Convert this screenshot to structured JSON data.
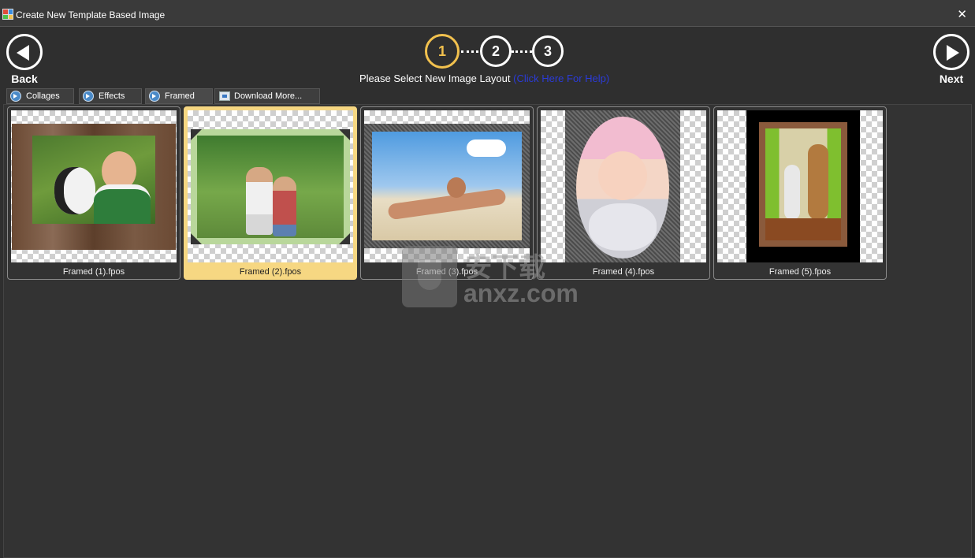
{
  "window": {
    "title": "Create New Template Based Image",
    "close_glyph": "✕"
  },
  "nav": {
    "back_label": "Back",
    "next_label": "Next"
  },
  "steps": {
    "items": [
      "1",
      "2",
      "3"
    ],
    "active": 1
  },
  "subtitle": {
    "text": "Please Select New Image Layout",
    "help_link": "(Click Here For Help)"
  },
  "tabs": [
    {
      "label": "Collages",
      "icon": "arrow-circle-icon"
    },
    {
      "label": "Effects",
      "icon": "arrow-circle-icon"
    },
    {
      "label": "Framed",
      "icon": "arrow-circle-icon",
      "active": true
    },
    {
      "label": "Download More...",
      "icon": "download-icon"
    }
  ],
  "templates": [
    {
      "name": "Framed (1).fpos"
    },
    {
      "name": "Framed (2).fpos",
      "selected": true
    },
    {
      "name": "Framed (3).fpos"
    },
    {
      "name": "Framed (4).fpos"
    },
    {
      "name": "Framed (5).fpos"
    }
  ],
  "watermark": {
    "cn": "安下载",
    "text": "anxz.com"
  },
  "colors": {
    "accent": "#f2c14e",
    "selected_card": "#f6d782",
    "help_link": "#2b3bd8",
    "background": "#2f2f2f"
  }
}
